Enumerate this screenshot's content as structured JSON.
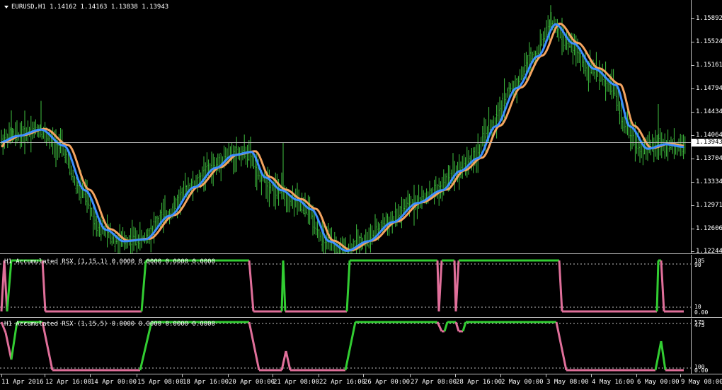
{
  "symbol_header": "EURUSD,H1  1.14162 1.14163 1.13838 1.13943",
  "current_price": "1.13943",
  "price_ticks": [
    "1.15892",
    "1.15524",
    "1.15161",
    "1.14794",
    "1.14434",
    "1.14064",
    "1.13704",
    "1.13334",
    "1.12971",
    "1.12606",
    "1.12244"
  ],
  "time_labels": [
    "11 Apr 2016",
    "12 Apr 16:00",
    "14 Apr 00:00",
    "15 Apr 08:00",
    "18 Apr 16:00",
    "20 Apr 00:00",
    "21 Apr 08:00",
    "22 Apr 16:00",
    "26 Apr 00:00",
    "27 Apr 08:00",
    "28 Apr 16:00",
    "2 May 00:00",
    "3 May 08:00",
    "4 May 16:00",
    "6 May 00:00",
    "9 May 08:00"
  ],
  "indicator1": {
    "title": "H1 Accumulated RSX (1,15,1) 0.0000 0.0000 0.0000 0.0000",
    "levels": [
      "105",
      "90",
      "10",
      "0.00"
    ]
  },
  "indicator2": {
    "title": "H1 Accumulated RSX (1,15,5) 0.0000 0.0000 0.0000 0.0000",
    "levels": [
      "575",
      "475",
      "100",
      "0.00"
    ]
  },
  "colors": {
    "background": "#000000",
    "bars": "#3fbf3f",
    "ma_blue": "#3c8fff",
    "ma_orange": "#f4a460",
    "ind_up": "#32cd32",
    "ind_down": "#e06f9a",
    "grid": "#c0c0c0"
  },
  "chart_data": {
    "type": "line",
    "title": "EURUSD,H1",
    "ylim": [
      1.12,
      1.161
    ],
    "x": [
      "11 Apr 2016",
      "12 Apr 16:00",
      "14 Apr 00:00",
      "15 Apr 08:00",
      "18 Apr 16:00",
      "20 Apr 00:00",
      "21 Apr 08:00",
      "22 Apr 16:00",
      "26 Apr 00:00",
      "27 Apr 08:00",
      "28 Apr 16:00",
      "2 May 00:00",
      "3 May 08:00",
      "4 May 16:00",
      "6 May 00:00",
      "9 May 08:00"
    ],
    "series": [
      {
        "values": [
          1.14,
          1.1415,
          1.138,
          1.126,
          1.1235,
          1.129,
          1.1345,
          1.136,
          1.129,
          1.123,
          1.126,
          1.134,
          1.144,
          1.1575,
          1.147,
          1.139,
          1.1385
        ]
      },
      {
        "values": [
          1.14,
          1.141,
          1.139,
          1.127,
          1.1238,
          1.128,
          1.133,
          1.1365,
          1.13,
          1.1235,
          1.125,
          1.133,
          1.142,
          1.158,
          1.149,
          1.14,
          1.139
        ]
      }
    ]
  }
}
